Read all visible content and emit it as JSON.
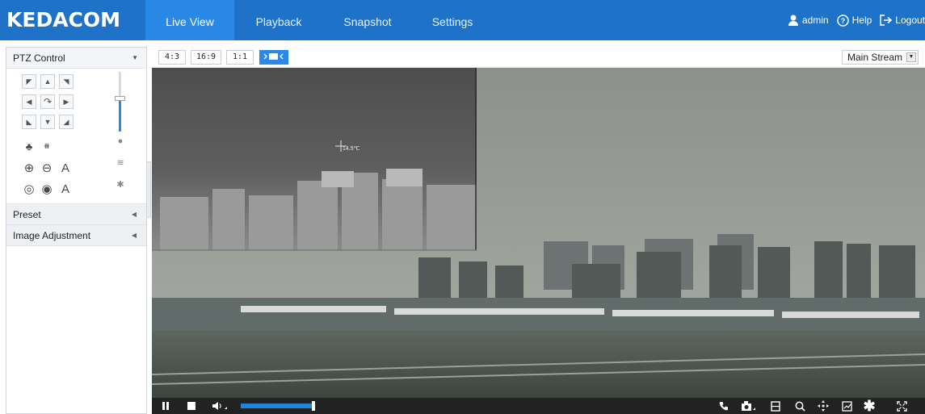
{
  "brand": {
    "name": "KEDACOM"
  },
  "nav": {
    "tabs": [
      {
        "label": "Live View",
        "active": true
      },
      {
        "label": "Playback"
      },
      {
        "label": "Snapshot"
      },
      {
        "label": "Settings"
      }
    ]
  },
  "user": {
    "name": "admin",
    "help": "Help",
    "logout": "Logout"
  },
  "left_panel": {
    "ptz": {
      "title": "PTZ Control",
      "zoom_level": 0.55
    },
    "preset": {
      "title": "Preset"
    },
    "image_adjustment": {
      "title": "Image Adjustment"
    }
  },
  "toolbar": {
    "ratios": [
      "4:3",
      "16:9",
      "1:1"
    ],
    "stream": {
      "selected": "Main Stream"
    }
  },
  "video": {
    "thermal_readout": "14.5℃"
  },
  "controls": {
    "volume_level": 0.85
  },
  "colors": {
    "header_bg": "#1e72c8",
    "active_tab": "#2a88e6",
    "accent": "#2a88e6"
  }
}
